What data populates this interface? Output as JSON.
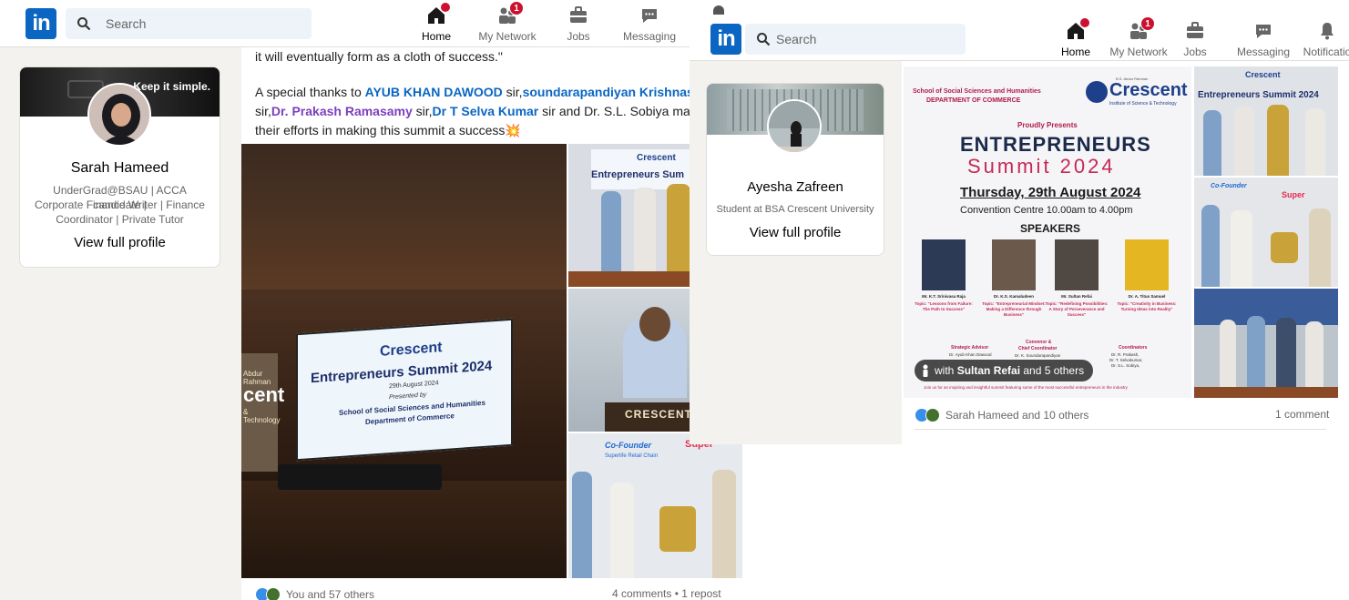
{
  "left": {
    "nav": {
      "search_placeholder": "Search",
      "items": [
        {
          "label": "Home",
          "badge": "",
          "active": true
        },
        {
          "label": "My Network",
          "badge": "1"
        },
        {
          "label": "Jobs",
          "badge": ""
        },
        {
          "label": "Messaging",
          "badge": ""
        }
      ]
    },
    "profile": {
      "banner_text": "Keep it simple.",
      "name": "Sarah Hameed",
      "headline_line1": "UnderGrad@BSAU | ACCA candidate |",
      "headline_line2": "Corporate Finance Writer | Finance",
      "headline_line3": "Coordinator | Private Tutor",
      "view_link": "View full profile"
    },
    "post": {
      "line1": "it will eventually form as a cloth of success.\"",
      "line2_prefix": "A special thanks to ",
      "mention1": "AYUB KHAN DAWOOD",
      "line2_mid": " sir,",
      "mention2": "soundarapandiyan Krishnasamy",
      "line3_prefix": " sir,",
      "mention3": "Dr. Prakash Ramasamy",
      "line3_mid": " sir,",
      "mention4": "Dr T Selva Kumar",
      "line3_suffix": " sir and Dr. S.L. Sobiya ma'am fo",
      "line4": "their efforts in making this summit a success💥",
      "main_image": {
        "screen_brand": "Crescent",
        "screen_title": "Entrepreneurs Summit 2024",
        "screen_date": "29th August 2024",
        "screen_presented_by": "Presented by",
        "screen_school": "School of Social Sciences and Humanities",
        "screen_dept": "Department of Commerce",
        "wall_text_1": "Abdur Rahman",
        "wall_text_2": "cent",
        "wall_text_3": "& Technology"
      },
      "tile1": {
        "brand": "Crescent",
        "title": "Entrepreneurs Sum"
      },
      "tile2": {
        "sign": "CRESCENT"
      },
      "tile3": {
        "co_founder": "Co-Founder",
        "retail": "Superlife Retail Chain",
        "super": "Super"
      },
      "reactions_text": "You and 57 others",
      "comments_text": "4 comments • 1 repost"
    }
  },
  "right": {
    "nav": {
      "search_placeholder": "Search",
      "items": [
        {
          "label": "Home",
          "badge": "",
          "active": true
        },
        {
          "label": "My Network",
          "badge": "1"
        },
        {
          "label": "Jobs",
          "badge": ""
        },
        {
          "label": "Messaging",
          "badge": ""
        },
        {
          "label": "Notificatio",
          "badge": ""
        }
      ]
    },
    "profile": {
      "name": "Ayesha Zafreen",
      "headline": "Student at BSA Crescent University",
      "view_link": "View full profile"
    },
    "poster": {
      "school": "School of Social Sciences and Humanities",
      "dept": "DEPARTMENT OF COMMERCE",
      "brand": "Crescent",
      "brand_small": "B.S. Abdur Rahman",
      "brand_sub": "Institute of Science & Technology",
      "proudly": "Proudly Presents",
      "title1": "ENTREPRENEURS",
      "title2": "Summit 2024",
      "date_text": "Thursday, 29th August 2024",
      "venue": "Convention Centre 10.00am to 4.00pm",
      "speakers_label": "SPEAKERS",
      "speakers": [
        {
          "name": "Mr. K.T. Srinivasa Raja",
          "topic": "Topic: \"Lessons from Failure: The Path to Success\""
        },
        {
          "name": "Dr. K.S. Kamaludeen",
          "topic": "Topic: \"Entrepreneurial Mindset: Making a Difference through Business\""
        },
        {
          "name": "Mr. Sultan Refai",
          "topic": "Topic: \"Redefining Possibilities: A Story of Perseverance and Success\""
        },
        {
          "name": "Dr. A. Titus Samuel",
          "topic": "Topic: \"Creativity in Business: Turning Ideas into Reality\""
        }
      ],
      "strategic_advisor": "Strategic Advisor",
      "advisor_name": "Dr. Ayub Khan Dawood",
      "convenor": "Convenor &",
      "chief": "Chief Coordinator",
      "convenor_name": "Dr. K. Soundarapandiyan",
      "coordinators": "Coordinators",
      "coord1": "Dr. R. Prakash,",
      "coord2": "Dr. T. Selvakumar,",
      "coord3": "Dr. S.L. Sobiya,",
      "footer": "Join us for an inspiring and insightful summit featuring some of the most successful entrepreneurs in the industry"
    },
    "tile1": {
      "brand": "Crescent",
      "title": "Entrepreneurs Summit 2024"
    },
    "tile2": {
      "co_founder": "Co-Founder",
      "super": "Super"
    },
    "caption": {
      "prefix": "with ",
      "name": "Sultan Refai",
      "suffix": " and 5 others"
    },
    "reactions_text": "Sarah Hameed and 10 others",
    "comments_text": "1 comment"
  }
}
